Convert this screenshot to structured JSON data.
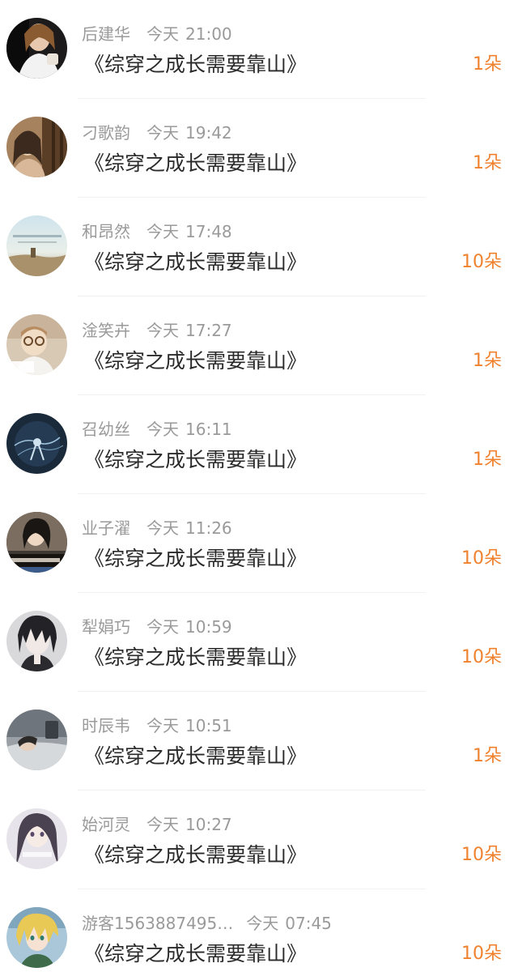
{
  "gifts_list": [
    {
      "name": "后建华",
      "date": "今天",
      "time": "21:00",
      "book": "《综穿之成长需要靠山》",
      "gift": "1朵",
      "avatar": "woman-white-top-avatar"
    },
    {
      "name": "刁歌韵",
      "date": "今天",
      "time": "19:42",
      "book": "《综穿之成长需要靠山》",
      "gift": "1朵",
      "avatar": "sepia-portrait-avatar"
    },
    {
      "name": "和昂然",
      "date": "今天",
      "time": "17:48",
      "book": "《综穿之成长需要靠山》",
      "gift": "10朵",
      "avatar": "sky-landscape-avatar"
    },
    {
      "name": "淦笑卉",
      "date": "今天",
      "time": "17:27",
      "book": "《综穿之成长需要靠山》",
      "gift": "1朵",
      "avatar": "child-glasses-avatar"
    },
    {
      "name": "召幼丝",
      "date": "今天",
      "time": "16:11",
      "book": "《综穿之成长需要靠山》",
      "gift": "1朵",
      "avatar": "dark-blue-figure-avatar"
    },
    {
      "name": "业子濯",
      "date": "今天",
      "time": "11:26",
      "book": "《综穿之成长需要靠山》",
      "gift": "10朵",
      "avatar": "girl-text-avatar"
    },
    {
      "name": "犁娟巧",
      "date": "今天",
      "time": "10:59",
      "book": "《综穿之成长需要靠山》",
      "gift": "10朵",
      "avatar": "anime-boy-avatar"
    },
    {
      "name": "时辰韦",
      "date": "今天",
      "time": "10:51",
      "book": "《综穿之成长需要靠山》",
      "gift": "1朵",
      "avatar": "sleeping-person-avatar"
    },
    {
      "name": "始河灵",
      "date": "今天",
      "time": "10:27",
      "book": "《综穿之成长需要靠山》",
      "gift": "10朵",
      "avatar": "anime-girl-avatar"
    },
    {
      "name": "游客1563887495…",
      "date": "今天",
      "time": "07:45",
      "book": "《综穿之成长需要靠山》",
      "gift": "10朵",
      "avatar": "anime-blonde-avatar"
    }
  ],
  "colors": {
    "gift_orange": "#f0822e",
    "meta_gray": "#9a9a9a",
    "title_dark": "#2a2a2a"
  }
}
